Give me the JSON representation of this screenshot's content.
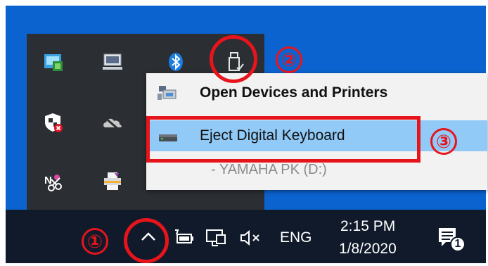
{
  "tray_overflow": {
    "icons": [
      "network-computer-icon",
      "laptop-display-icon",
      "bluetooth-icon",
      "usb-drive-icon",
      "windows-security-alert-icon",
      "onedrive-icon",
      "onenote-clip-icon",
      "printer-stack-icon"
    ]
  },
  "context_menu": {
    "items": [
      {
        "label": "Open Devices and Printers",
        "icon": "devices-printers-icon"
      },
      {
        "label": "Eject Digital Keyboard",
        "icon": "drive-icon"
      }
    ],
    "sub_item": "-   YAMAHA PK (D:)"
  },
  "taskbar": {
    "language": "ENG",
    "time": "2:15 PM",
    "date": "1/8/2020",
    "notification_count": "1",
    "icons": [
      "chevron-up-icon",
      "battery-icon",
      "network-icon",
      "volume-muted-icon",
      "action-center-icon"
    ]
  },
  "annotations": {
    "step1": "①",
    "step2": "②",
    "step3": "③",
    "color": "#e8141b"
  },
  "colors": {
    "desktop_blue": "#0b63cf",
    "tray_panel": "#2b2f33",
    "menu_highlight": "#91c9f7",
    "taskbar": "#101a2b"
  }
}
